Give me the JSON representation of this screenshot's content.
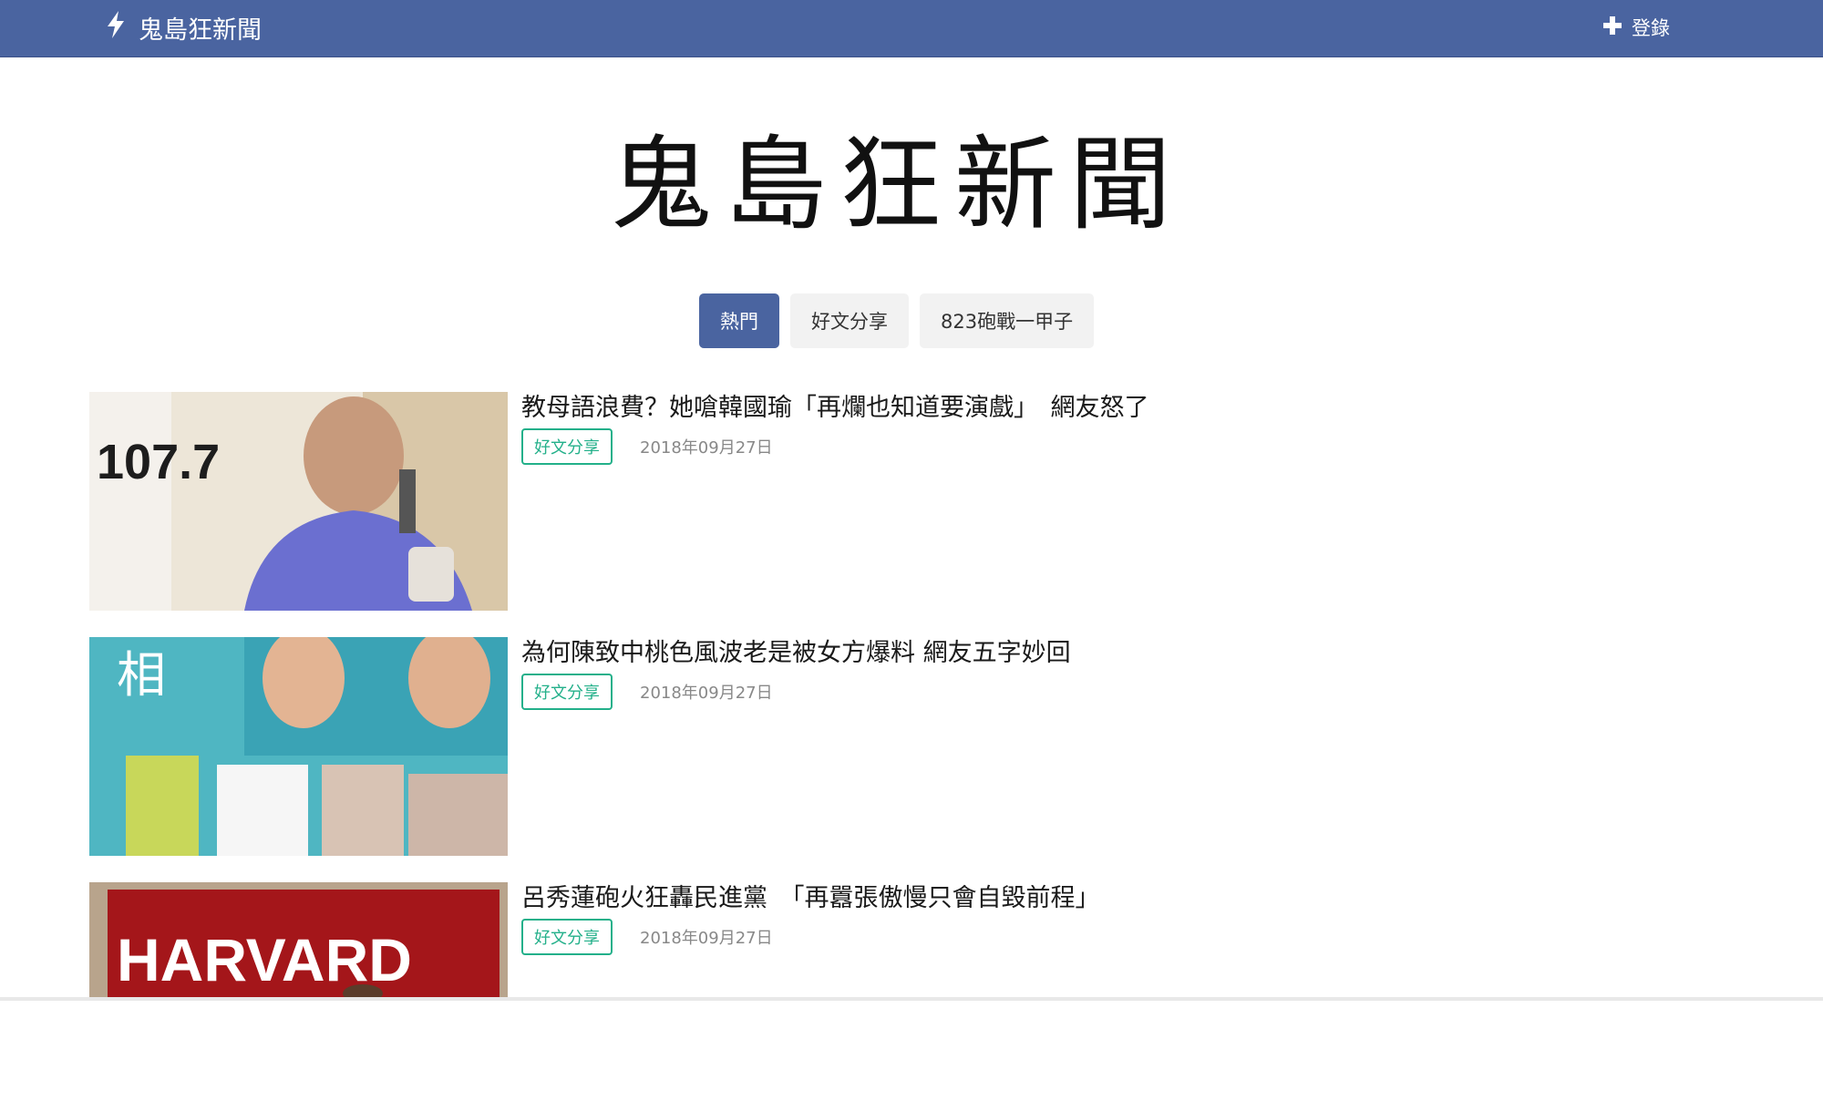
{
  "navbar": {
    "brand_icon": "lightning-bolt-icon",
    "brand_label": "鬼島狂新聞",
    "login_icon": "plus-icon",
    "login_label": "登錄",
    "color": "#4a64a0"
  },
  "hero": {
    "title": "鬼島狂新聞"
  },
  "tabs": [
    {
      "label": "熱門",
      "active": true
    },
    {
      "label": "好文分享",
      "active": false
    },
    {
      "label": "823砲戰一甲子",
      "active": false
    }
  ],
  "articles": [
    {
      "title": "教母語浪費？她嗆韓國瑜「再爛也知道要演戲」　網友怒了",
      "category": "好文分享",
      "date": "2018年09月27日",
      "thumb_text": "107.7"
    },
    {
      "title": "為何陳致中桃色風波老是被女方爆料 網友五字妙回",
      "category": "好文分享",
      "date": "2018年09月27日",
      "thumb_text": "相"
    },
    {
      "title": "呂秀蓮砲火狂轟民進黨　「再囂張傲慢只會自毀前程」",
      "category": "好文分享",
      "date": "2018年09月27日",
      "thumb_text": "HARVARD"
    }
  ],
  "colors": {
    "accent": "#4a64a0",
    "badge": "#23b08a"
  }
}
